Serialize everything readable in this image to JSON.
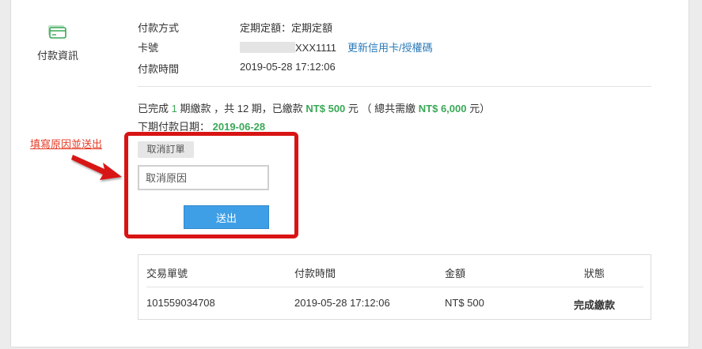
{
  "sidebar": {
    "label": "付款資訊",
    "icon": "credit-card-icon",
    "icon_color": "#3aa857"
  },
  "payment": {
    "method_label": "付款方式",
    "method_value": "定期定額：定期定額",
    "card_label": "卡號",
    "card_suffix": "XXX1111",
    "card_link": "更新信用卡/授權碼",
    "time_label": "付款時間",
    "time_value": "2019-05-28 17:12:06"
  },
  "summary": {
    "p1": "已完成",
    "done_count": "1",
    "p2": "期繳款 ，共 12 期，已繳款",
    "paid_amount": "NT$ 500",
    "p3": "元 （ 總共需繳",
    "total_amount": "NT$ 6,000",
    "p4": "元）",
    "next_label": "下期付款日期：",
    "next_date": "2019-06-28"
  },
  "annotation": {
    "text": "填寫原因並送出",
    "color": "#e53c27",
    "box_color": "#d81414"
  },
  "cancel": {
    "tag": "取消訂單",
    "reason_placeholder": "取消原因",
    "submit_label": "送出",
    "submit_color": "#3f9fe6"
  },
  "table": {
    "headers": [
      "交易單號",
      "付款時間",
      "金額",
      "狀態"
    ],
    "rows": [
      [
        "101559034708",
        "2019-05-28 17:12:06",
        "NT$ 500",
        "完成繳款"
      ]
    ],
    "status_color": "#3aa857"
  }
}
